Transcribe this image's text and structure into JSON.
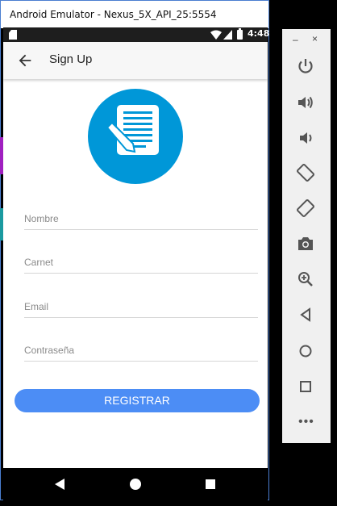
{
  "window": {
    "title": "Android Emulator - Nexus_5X_API_25:5554"
  },
  "status_bar": {
    "time": "4:48",
    "icons": [
      "sd-card-icon",
      "wifi-icon",
      "signal-icon",
      "battery-icon"
    ]
  },
  "app_bar": {
    "title": "Sign Up",
    "back_icon": "arrow-back-icon"
  },
  "header_icon": "document-edit-icon",
  "form": {
    "nombre_placeholder": "Nombre",
    "carnet_placeholder": "Carnet",
    "email_placeholder": "Email",
    "password_placeholder": "Contraseña",
    "submit_label": "REGISTRAR"
  },
  "colors": {
    "accent": "#4c8df5",
    "icon_circle": "#0097d8",
    "toolbar": "#f0f0f0"
  },
  "nav_bar": {
    "icons": [
      "back-triangle-icon",
      "home-circle-icon",
      "recents-square-icon"
    ]
  },
  "toolbar": {
    "minimize": "–",
    "close": "×",
    "more": "•••",
    "icons": [
      "power-icon",
      "volume-up-icon",
      "volume-down-icon",
      "rotate-left-icon",
      "rotate-right-icon",
      "camera-icon",
      "zoom-icon",
      "back-icon",
      "home-icon",
      "overview-icon",
      "more-icon"
    ]
  }
}
